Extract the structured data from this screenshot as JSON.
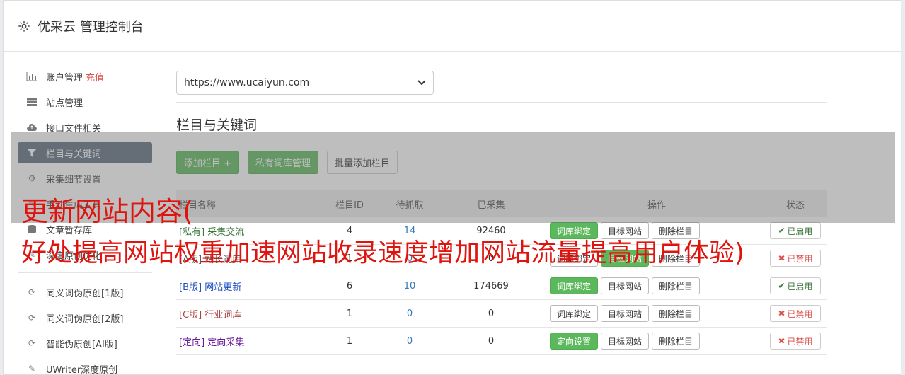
{
  "header": {
    "title": "优采云 管理控制台",
    "icon": "gear-icon"
  },
  "sidebar": {
    "items": [
      {
        "label": "账户管理",
        "badge": "充值",
        "icon": "bar-chart-icon"
      },
      {
        "label": "站点管理",
        "icon": "server-icon"
      },
      {
        "label": "接口文件相关",
        "icon": "cloud-upload-icon"
      },
      {
        "label": "栏目与关键词",
        "icon": "filter-icon",
        "active": true
      },
      {
        "label": "采集细节设置",
        "icon": "gears-icon"
      },
      {
        "label": "手动生成工具",
        "icon": "tool-icon"
      },
      {
        "label": "文章暂存库",
        "icon": "database-icon"
      },
      {
        "label": "深度原创优化",
        "icon": "edit-icon"
      }
    ],
    "items2": [
      {
        "label": "同义词伪原创[1版]",
        "icon": "refresh-icon"
      },
      {
        "label": "同义词伪原创[2版]",
        "icon": "refresh-icon"
      },
      {
        "label": "智能伪原创[AI版]",
        "icon": "refresh-icon"
      },
      {
        "label": "UWriter深度原创",
        "icon": "edit-icon"
      }
    ]
  },
  "main": {
    "site_select": "https://www.ucaiyun.com",
    "section_title": "栏目与关键词",
    "buttons": {
      "add_column": "添加栏目 +",
      "private_lib": "私有词库管理",
      "batch_add": "批量添加栏目"
    },
    "table": {
      "headers": {
        "name": "栏目名称",
        "id": "栏目ID",
        "wait": "待抓取",
        "done": "已采集",
        "ops": "操作",
        "status": "状态"
      },
      "rows": [
        {
          "name": "[私有] 采集交流",
          "id": "4",
          "wait": "14",
          "done": "92460",
          "op1": "词库绑定",
          "op2": "目标网站",
          "op3": "删除栏目",
          "status": "已启用"
        },
        {
          "name": "[A版] 站长词库",
          "id": "1",
          "wait": "0",
          "done": "0",
          "op1": "词库绑定",
          "op2": "目标网站",
          "op3": "删除栏目",
          "status": "已禁用"
        },
        {
          "name": "[B版] 网站更新",
          "id": "6",
          "wait": "10",
          "done": "174669",
          "op1": "词库绑定",
          "op2": "目标网站",
          "op3": "删除栏目",
          "status": "已启用"
        },
        {
          "name": "[C版] 行业词库",
          "id": "1",
          "wait": "0",
          "done": "0",
          "op1": "词库绑定",
          "op2": "目标网站",
          "op3": "删除栏目",
          "status": "已禁用"
        },
        {
          "name": "[定向] 定向采集",
          "id": "1",
          "wait": "0",
          "done": "0",
          "op1": "定向设置",
          "op2": "目标网站",
          "op3": "删除栏目",
          "status": "已禁用"
        }
      ]
    }
  },
  "overlay": {
    "line1": "更新网站内容(",
    "line2": "好处提高网站权重加速网站收录速度增加网站流量提高用户体验)"
  },
  "colors": {
    "accent_green": "#5cb85c",
    "nav_active": "#5d6d7e",
    "danger": "#d9534f",
    "overlay_text": "#e0140f"
  }
}
